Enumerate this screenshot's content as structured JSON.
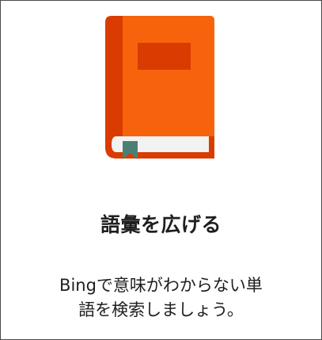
{
  "card": {
    "title": "語彙を広げる",
    "description_line1": "Bingで意味がわからない単",
    "description_line2": "語を検索しましょう。"
  },
  "icons": {
    "book": "book-icon"
  },
  "colors": {
    "book_cover": "#F7630C",
    "book_spine": "#DA3B01",
    "book_label": "#DA3B01",
    "book_pages": "#F2F2F2",
    "bookmark": "#4A8074",
    "text": "#1F1F1F",
    "border": "#4A4A4A"
  }
}
